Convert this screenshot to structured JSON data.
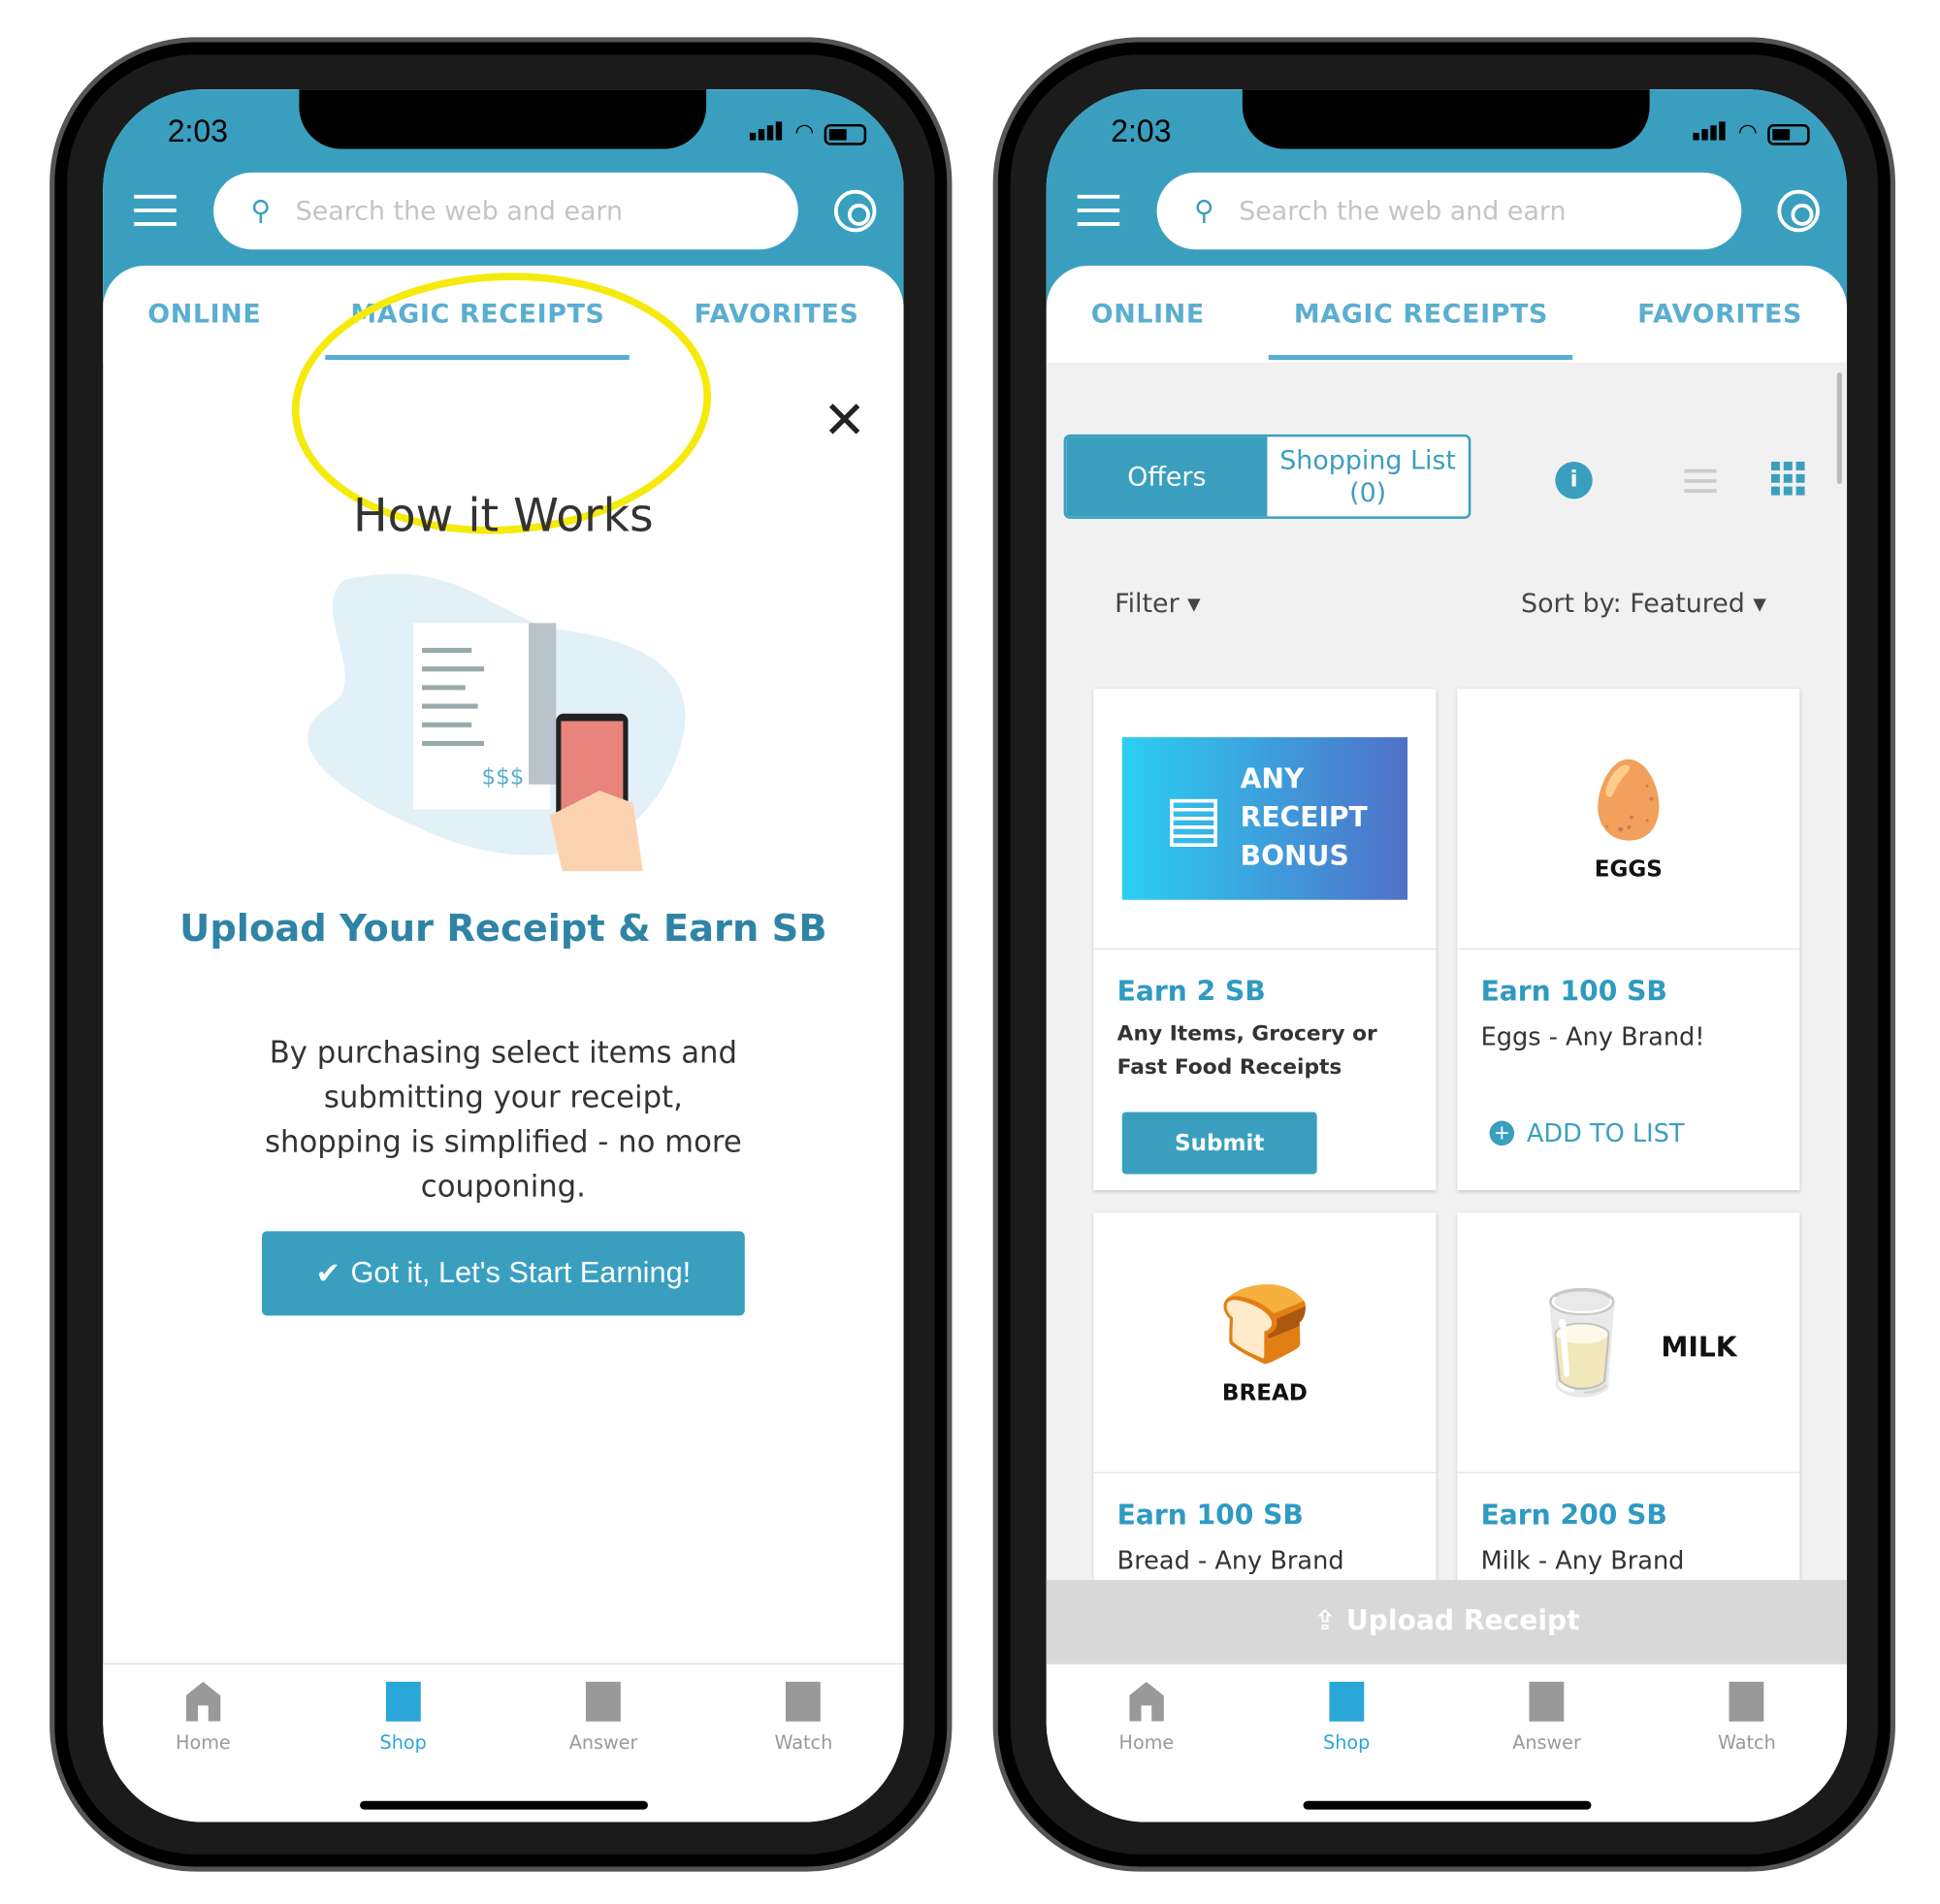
{
  "status": {
    "time": "2:03"
  },
  "search": {
    "placeholder": "Search the web and earn"
  },
  "tabs": [
    {
      "label": "ONLINE"
    },
    {
      "label": "MAGIC RECEIPTS"
    },
    {
      "label": "FAVORITES"
    }
  ],
  "left": {
    "close": "✕",
    "title": "How it Works",
    "heading": "Upload Your Receipt & Earn SB",
    "description": "By purchasing select items and submitting your receipt, shopping is simplified - no more couponing.",
    "cta": "Got it, Let's Start Earning!",
    "highlight_color": "#f5ea0c",
    "illustration_text": "$$$"
  },
  "right": {
    "segments": {
      "offers": "Offers",
      "shopping_list": "Shopping List (0)"
    },
    "filter": "Filter ▾",
    "sort": "Sort by: Featured ▾",
    "cards": [
      {
        "image_text": "ANY RECEIPT BONUS",
        "earn": "Earn 2 SB",
        "desc": "Any Items, Grocery or Fast Food Receipts",
        "action": "Submit"
      },
      {
        "image_text": "EGGS",
        "earn": "Earn 100 SB",
        "desc": "Eggs - Any Brand!",
        "action": "ADD TO LIST"
      },
      {
        "image_text": "BREAD",
        "earn": "Earn 100 SB",
        "desc": "Bread - Any Brand"
      },
      {
        "image_text": "MILK",
        "earn": "Earn 200 SB",
        "desc": "Milk - Any Brand"
      }
    ],
    "upload": "Upload Receipt"
  },
  "nav": [
    {
      "label": "Home"
    },
    {
      "label": "Shop"
    },
    {
      "label": "Answer"
    },
    {
      "label": "Watch"
    }
  ],
  "colors": {
    "primary": "#3a9fbf",
    "active_nav": "#2ba6d9"
  }
}
